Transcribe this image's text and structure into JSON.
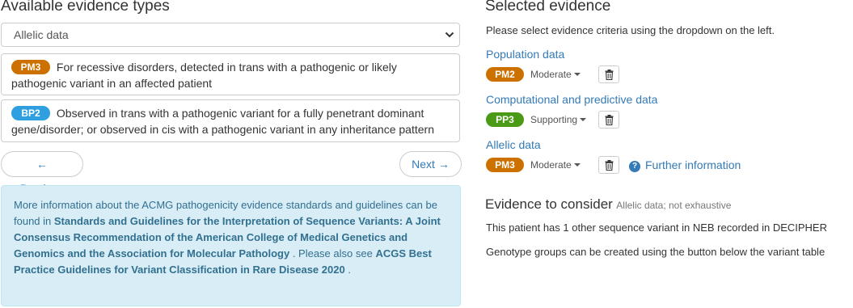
{
  "left": {
    "title": "Available evidence types",
    "select": {
      "value": "Allelic data"
    },
    "evidence_items": [
      {
        "code": "PM3",
        "text": "For recessive disorders, detected in trans with a pathogenic or likely pathogenic variant in an affected patient",
        "color": "#cc7000"
      },
      {
        "code": "BP2",
        "text": "Observed in trans with a pathogenic variant for a fully penetrant dominant gene/disorder; or observed in cis with a pathogenic variant in any inheritance pattern",
        "color": "#2f9fe0"
      }
    ],
    "nav": {
      "previous": "← Previous",
      "next": "Next →"
    },
    "info": {
      "t1": "More information about the ACMG pathogenicity evidence standards and guidelines can be found in",
      "b1": "Standards and Guidelines for the Interpretation of Sequence Variants: A Joint Consensus Recommendation of the American College of Medical Genetics and Genomics and the Association for Molecular Pathology",
      "t2": ". Please also see",
      "b2": "ACGS Best Practice Guidelines for Variant Classification in Rare Disease 2020",
      "t3": "."
    }
  },
  "right": {
    "title": "Selected evidence",
    "instruction": "Please select evidence criteria using the dropdown on the left.",
    "groups": [
      {
        "heading": "Population data",
        "code": "PM2",
        "strength": "Moderate",
        "color": "#cc7000"
      },
      {
        "heading": "Computational and predictive data",
        "code": "PP3",
        "strength": "Supporting",
        "color": "#4a9a16"
      },
      {
        "heading": "Allelic data",
        "code": "PM3",
        "strength": "Moderate",
        "color": "#cc7000",
        "further": "Further information"
      }
    ],
    "consider": {
      "title": "Evidence to consider",
      "subtitle": "Allelic data; not exhaustive",
      "line1": "This patient has 1 other sequence variant in NEB recorded in DECIPHER",
      "line2": "Genotype groups can be created using the button below the variant table"
    }
  }
}
